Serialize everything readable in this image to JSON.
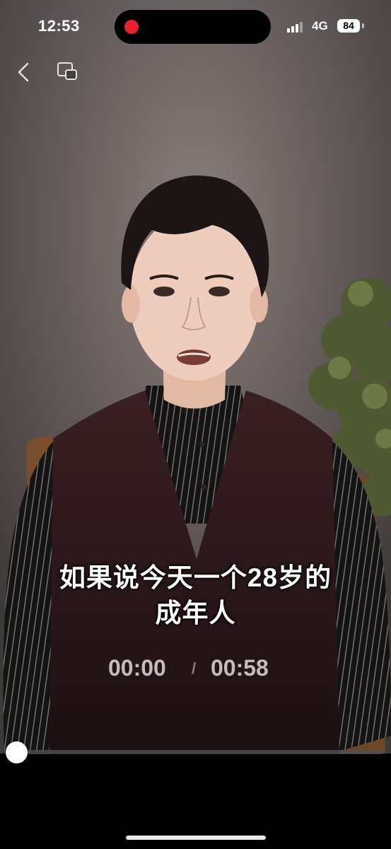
{
  "status_bar": {
    "time": "12:53",
    "network": "4G",
    "battery": "84",
    "recording_color": "#e8212b"
  },
  "nav": {
    "back_icon": "chevron-left-icon",
    "pip_icon": "picture-in-picture-icon"
  },
  "video": {
    "caption_line1": "如果说今天一个28岁的",
    "caption_line2": "成年人",
    "current_time": "00:00",
    "separator": "/",
    "duration": "00:58",
    "progress": 0.0
  },
  "colors": {
    "background": "#000000",
    "caption_text": "#ffffff",
    "progress_track": "#505050",
    "progress_knob": "#ffffff"
  }
}
